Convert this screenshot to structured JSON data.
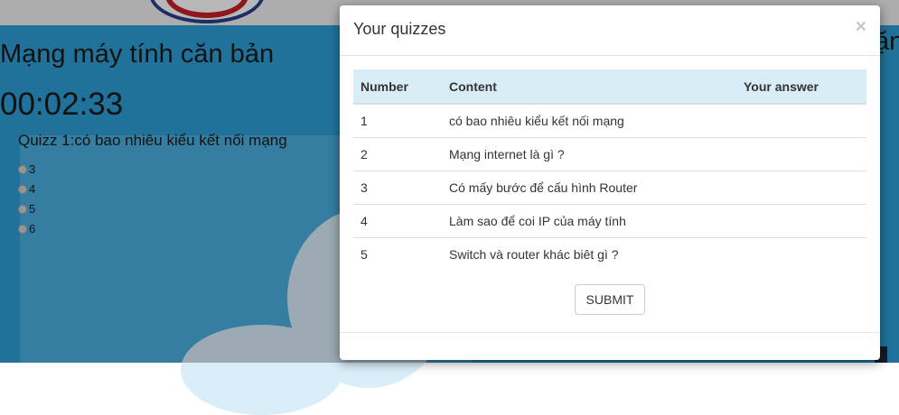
{
  "page": {
    "title": "Mạng máy tính căn bản",
    "timer": "00:02:33",
    "question": "Quizz 1:có bao nhiêu kiểu kết nối mạng",
    "options": [
      "3",
      "4",
      "5",
      "6"
    ],
    "right_title_fragment": "ặn"
  },
  "modal": {
    "title": "Your quizzes",
    "close_symbol": "×",
    "columns": {
      "number": "Number",
      "content": "Content",
      "answer": "Your answer"
    },
    "rows": [
      {
        "number": "1",
        "content": "có bao nhiêu kiểu kết nối mạng",
        "answer": ""
      },
      {
        "number": "2",
        "content": "Mạng internet là gì ?",
        "answer": ""
      },
      {
        "number": "3",
        "content": "Có mấy bước để cấu hình Router",
        "answer": ""
      },
      {
        "number": "4",
        "content": "Làm sao để coi IP của máy tính",
        "answer": ""
      },
      {
        "number": "5",
        "content": "Switch và router khác biêt gì ?",
        "answer": ""
      }
    ],
    "submit_label": "SUBMIT"
  },
  "colors": {
    "background_blue": "#2e9fd6",
    "table_header": "#d9edf7"
  }
}
